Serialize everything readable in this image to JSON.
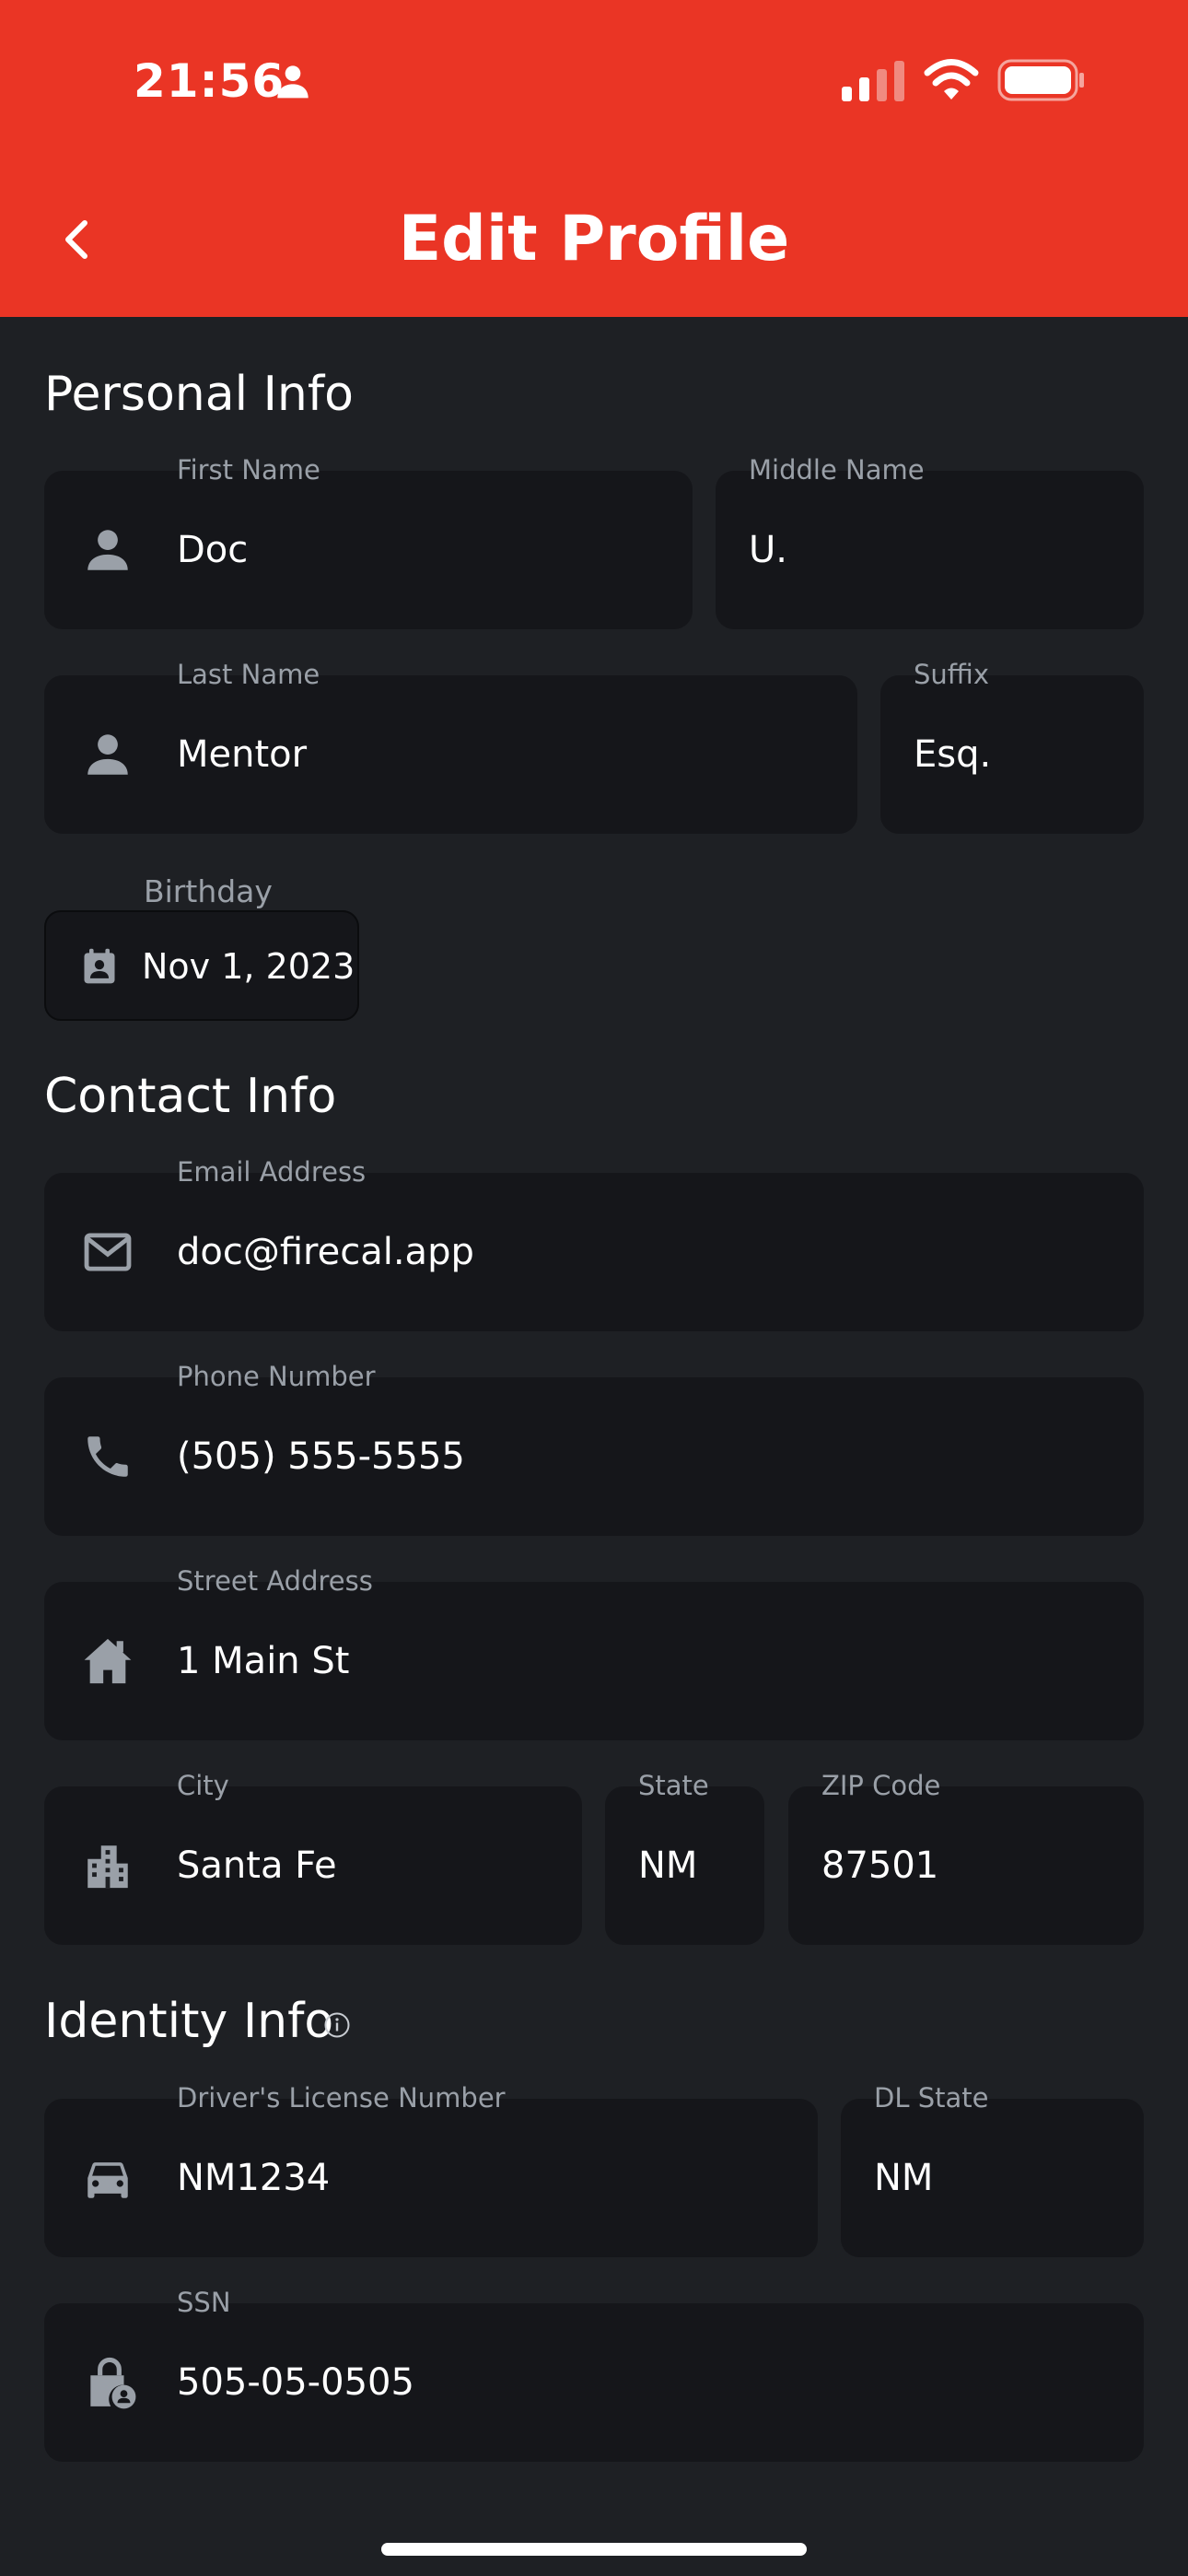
{
  "status_bar": {
    "time": "21:56",
    "icons": [
      "person-icon",
      "cellular-signal-icon",
      "wifi-icon",
      "battery-icon"
    ]
  },
  "header": {
    "title": "Edit Profile",
    "back_icon": "chevron-left-icon",
    "background_color": "#ea3525"
  },
  "sections": {
    "personal": {
      "title": "Personal Info"
    },
    "contact": {
      "title": "Contact Info"
    },
    "identity": {
      "title": "Identity Info",
      "info_icon": "info-circle-icon"
    }
  },
  "fields": {
    "first_name": {
      "label": "First Name",
      "value": "Doc",
      "icon": "person-icon"
    },
    "middle_name": {
      "label": "Middle Name",
      "value": "U."
    },
    "last_name": {
      "label": "Last Name",
      "value": "Mentor",
      "icon": "person-icon"
    },
    "suffix": {
      "label": "Suffix",
      "value": "Esq."
    },
    "birthday": {
      "label": "Birthday",
      "value": "Nov 1, 2023",
      "icon": "calendar-contact-icon"
    },
    "email": {
      "label": "Email Address",
      "value": "doc@firecal.app",
      "icon": "mail-icon"
    },
    "phone": {
      "label": "Phone Number",
      "value": "(505) 555-5555",
      "icon": "phone-icon"
    },
    "street": {
      "label": "Street Address",
      "value": "1 Main St",
      "icon": "house-icon"
    },
    "city": {
      "label": "City",
      "value": "Santa Fe",
      "icon": "building-icon"
    },
    "state": {
      "label": "State",
      "value": "NM"
    },
    "zip": {
      "label": "ZIP Code",
      "value": "87501"
    },
    "dl_number": {
      "label": "Driver's License Number",
      "value": "NM1234",
      "icon": "car-icon"
    },
    "dl_state": {
      "label": "DL State",
      "value": "NM"
    },
    "ssn": {
      "label": "SSN",
      "value": "505-05-0505",
      "icon": "lock-person-icon"
    }
  },
  "colors": {
    "background": "#1e2024",
    "field_background": "#15161a",
    "label": "#9aa0a8",
    "icon": "#9aa0a8"
  }
}
